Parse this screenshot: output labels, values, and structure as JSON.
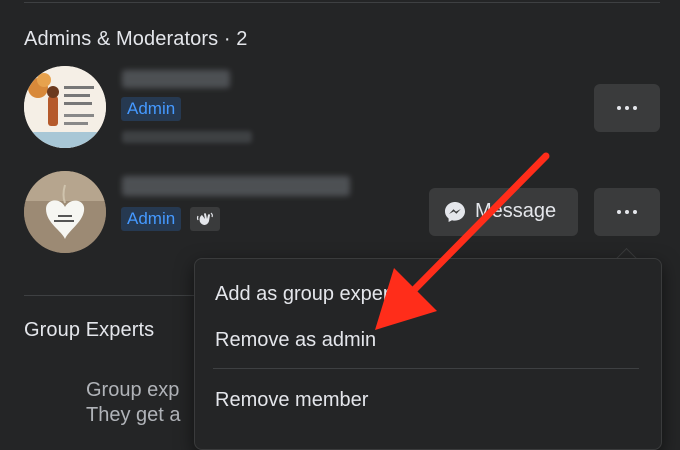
{
  "admins_section": {
    "title": "Admins & Moderators · 2"
  },
  "members": [
    {
      "badge": "Admin",
      "more_icon": "more-horizontal-icon"
    },
    {
      "badge": "Admin",
      "badge_icon": "waving-hand-icon",
      "message_label": "Message",
      "message_icon": "messenger-icon",
      "more_icon": "more-horizontal-icon"
    }
  ],
  "experts_section": {
    "title": "Group Experts",
    "desc_line1": "Group exp",
    "desc_line2": "They get a"
  },
  "menu": {
    "items": [
      "Add as group expert",
      "Remove as admin",
      "Remove member"
    ]
  },
  "annotation": {
    "color": "#ff2d1a"
  },
  "colors": {
    "background": "#242526",
    "button": "#3a3b3c",
    "admin_badge_text": "#4599ff",
    "admin_badge_bg": "#263951"
  }
}
